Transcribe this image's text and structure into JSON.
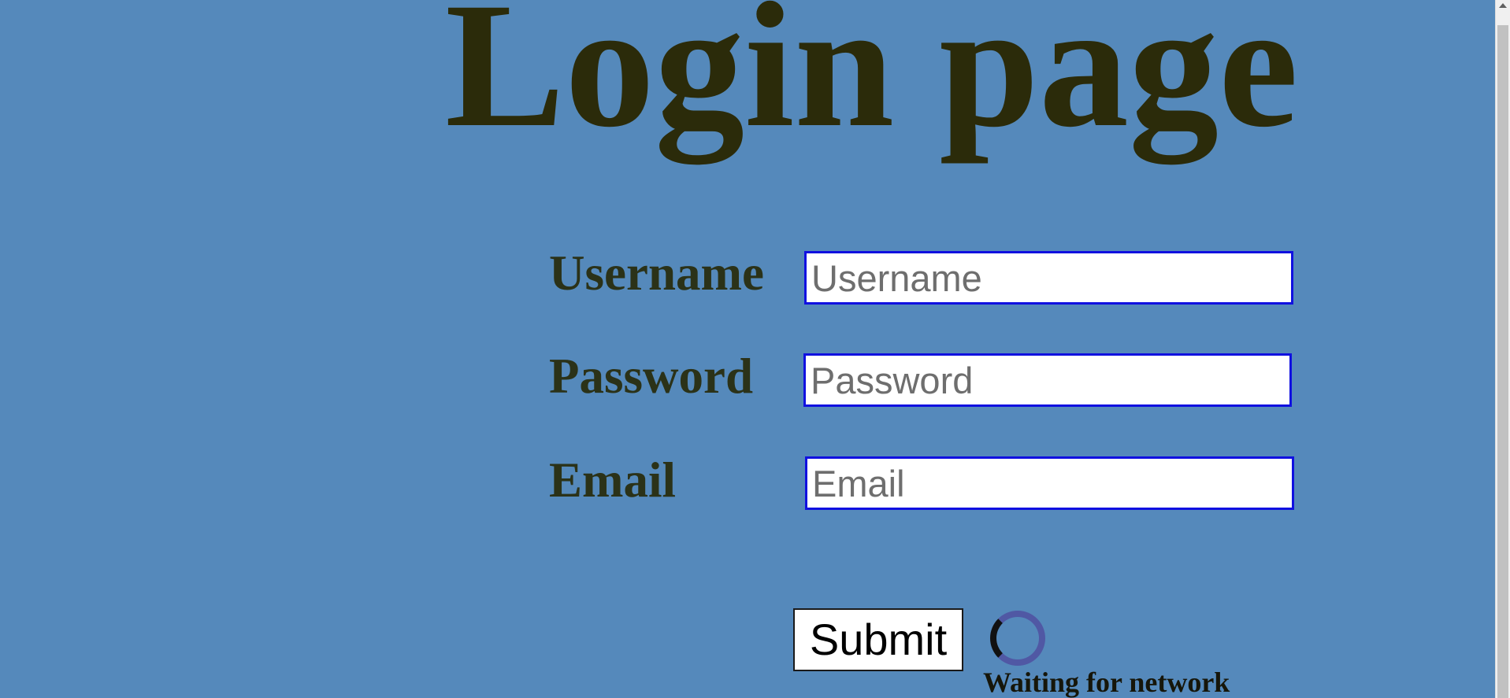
{
  "page": {
    "title": "Login page",
    "background_color": "#5589bb"
  },
  "form": {
    "fields": [
      {
        "label": "Username",
        "placeholder": "Username",
        "value": ""
      },
      {
        "label": "Password",
        "placeholder": "Password",
        "value": ""
      },
      {
        "label": "Email",
        "placeholder": "Email",
        "value": ""
      }
    ],
    "submit_label": "Submit"
  },
  "status": {
    "icon": "loading-spinner-icon",
    "text": "Waiting for network"
  },
  "colors": {
    "title": "#2b2b0a",
    "input_border": "#1010e0",
    "spinner_ring": "#5058a4",
    "spinner_arc": "#111111"
  }
}
